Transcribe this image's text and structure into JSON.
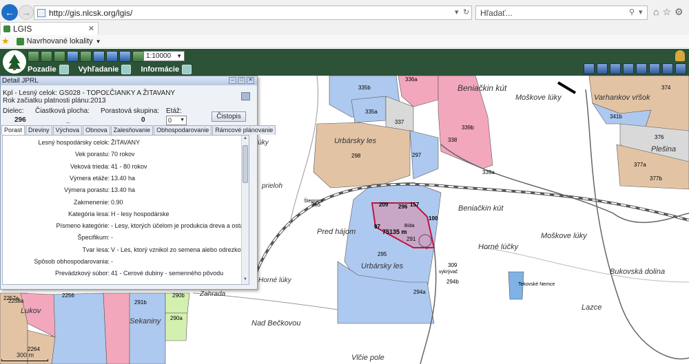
{
  "browser": {
    "url": "http://gis.nlcsk.org/lgis/",
    "search_placeholder": "Hľadať...",
    "tab_title": "LGIS",
    "favorite_label": "Navrhované lokality"
  },
  "toolbar": {
    "scale": "1:10000",
    "menu": {
      "background": "Pozadie",
      "search": "Vyhľadanie",
      "info": "Informácie"
    }
  },
  "panel": {
    "title": "Detail JPRL",
    "unit_line": "Kpl - Lesný celok: GS028 - TOPOĽČIANKY A ŽITAVANY",
    "year_line": "Rok začiatku platnosti plánu:2013",
    "caps": {
      "dielec": "Dielec:",
      "plocha": "Čiastková plocha:",
      "skupina": "Porastová skupina:",
      "etaz": "Etáž:"
    },
    "vals": {
      "dielec": "296",
      "plocha": "_",
      "skupina": "0",
      "etaz": "0"
    },
    "cistopis": "Čistopis",
    "tabs": [
      "Porast",
      "Dreviny",
      "Výchova",
      "Obnova",
      "Zalesňovanie",
      "Obhospodarovanie",
      "Rámcové plánovanie"
    ],
    "rows": [
      {
        "k": "Lesný hospodársky celok:",
        "v": "ŽITAVANY"
      },
      {
        "k": "Vek porastu:",
        "v": "70 rokov"
      },
      {
        "k": "Veková trieda:",
        "v": "41 - 80 rokov"
      },
      {
        "k": "Výmera etáže:",
        "v": "13.40 ha"
      },
      {
        "k": "Výmera porastu:",
        "v": "13.40 ha"
      },
      {
        "k": "Zakmenenie:",
        "v": "0.90"
      },
      {
        "k": "Kategória lesa:",
        "v": "H - lesy hospodárske"
      },
      {
        "k": "Písmeno kategórie:",
        "v": "- Lesy, ktorých účelom je produkcia dreva a ostatn"
      },
      {
        "k": "Špecifikum:",
        "v": "-"
      },
      {
        "k": "Tvar lesa:",
        "v": "V - Les, ktorý vznikol zo semena alebo odrezkov."
      },
      {
        "k": "Spôsob obhospodarovania:",
        "v": "-"
      },
      {
        "k": "Prevádzkový súbor:",
        "v": "41 - Cerové dubiny - semenného pôvodu"
      }
    ]
  },
  "map": {
    "scalebar": "300 m",
    "stands": [
      "335b",
      "336a",
      "335a",
      "337",
      "339b",
      "338",
      "339a",
      "298",
      "297",
      "374",
      "341b",
      "376",
      "377a",
      "377b",
      "209",
      "296",
      "157",
      "100",
      "97",
      "291",
      "295",
      "294a",
      "294b",
      "309",
      "2257a",
      "2256",
      "291b",
      "290b",
      "290a",
      "2258a",
      "2264",
      "265"
    ],
    "places": [
      "Beniačkin kút",
      "Moškove lúky",
      "Varhankov vŕšok",
      "Urbársky les",
      "Plešina",
      "Beniačkin kút",
      "Pred hájom",
      "Moškove lúky",
      "Horné lúčky",
      "Bukovská dolina",
      "Lazce",
      "Nad Bečkovou",
      "Lukov",
      "Sekaniny",
      "Vlčie pole",
      "Zahrada",
      "Horné lúky",
      "prieloh",
      "lúky",
      "Urbársky les"
    ],
    "measure": "75135 m",
    "point_labels": [
      "Štepnica",
      "Bída",
      "vykrývač",
      "Tekovské Nemce"
    ]
  }
}
